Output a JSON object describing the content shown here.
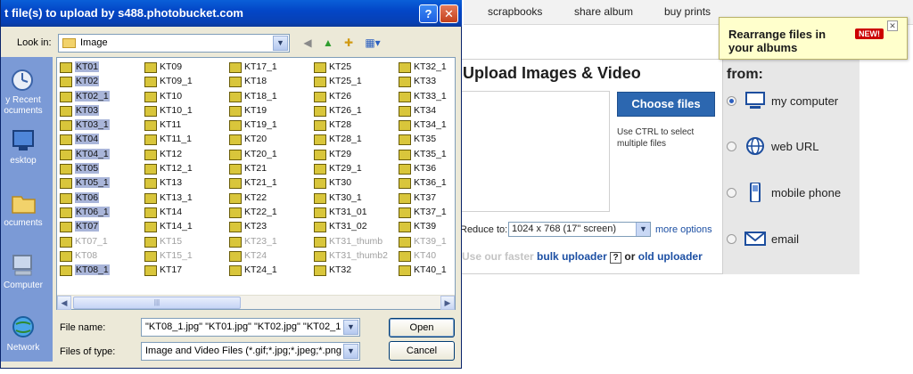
{
  "dialog": {
    "title": "t file(s) to upload by s488.photobucket.com",
    "help_label": "?",
    "close_label": "✕",
    "look_in_label": "Look in:",
    "look_in_value": "Image",
    "places": [
      {
        "label": "y Recent\nocuments",
        "icon": "recent-documents-icon"
      },
      {
        "label": "esktop",
        "icon": "desktop-icon"
      },
      {
        "label": "ocuments",
        "icon": "my-documents-icon"
      },
      {
        "label": "Computer",
        "icon": "my-computer-icon"
      },
      {
        "label": "Network",
        "icon": "network-icon"
      }
    ],
    "file_columns": [
      [
        {
          "name": "KT01",
          "sel": true
        },
        {
          "name": "KT02",
          "sel": true
        },
        {
          "name": "KT02_1",
          "sel": true
        },
        {
          "name": "KT03",
          "sel": true
        },
        {
          "name": "KT03_1",
          "sel": true
        },
        {
          "name": "KT04",
          "sel": true
        },
        {
          "name": "KT04_1",
          "sel": true
        },
        {
          "name": "KT05",
          "sel": true
        },
        {
          "name": "KT05_1",
          "sel": true
        },
        {
          "name": "KT06",
          "sel": true
        },
        {
          "name": "KT06_1",
          "sel": true
        },
        {
          "name": "KT07",
          "sel": true
        },
        {
          "name": "KT07_1",
          "dim": true
        },
        {
          "name": "KT08",
          "dim": true
        },
        {
          "name": "KT08_1",
          "sel": true
        }
      ],
      [
        {
          "name": "KT09"
        },
        {
          "name": "KT09_1"
        },
        {
          "name": "KT10"
        },
        {
          "name": "KT10_1"
        },
        {
          "name": "KT11"
        },
        {
          "name": "KT11_1"
        },
        {
          "name": "KT12"
        },
        {
          "name": "KT12_1"
        },
        {
          "name": "KT13"
        },
        {
          "name": "KT13_1"
        },
        {
          "name": "KT14"
        },
        {
          "name": "KT14_1"
        },
        {
          "name": "KT15",
          "dim": true
        },
        {
          "name": "KT15_1",
          "dim": true
        },
        {
          "name": "KT17"
        }
      ],
      [
        {
          "name": "KT17_1"
        },
        {
          "name": "KT18"
        },
        {
          "name": "KT18_1"
        },
        {
          "name": "KT19"
        },
        {
          "name": "KT19_1"
        },
        {
          "name": "KT20"
        },
        {
          "name": "KT20_1"
        },
        {
          "name": "KT21"
        },
        {
          "name": "KT21_1"
        },
        {
          "name": "KT22"
        },
        {
          "name": "KT22_1"
        },
        {
          "name": "KT23"
        },
        {
          "name": "KT23_1",
          "dim": true
        },
        {
          "name": "KT24",
          "dim": true
        },
        {
          "name": "KT24_1"
        }
      ],
      [
        {
          "name": "KT25"
        },
        {
          "name": "KT25_1"
        },
        {
          "name": "KT26"
        },
        {
          "name": "KT26_1"
        },
        {
          "name": "KT28"
        },
        {
          "name": "KT28_1"
        },
        {
          "name": "KT29"
        },
        {
          "name": "KT29_1"
        },
        {
          "name": "KT30"
        },
        {
          "name": "KT30_1"
        },
        {
          "name": "KT31_01"
        },
        {
          "name": "KT31_02"
        },
        {
          "name": "KT31_thumb",
          "dim": true
        },
        {
          "name": "KT31_thumb2",
          "dim": true
        },
        {
          "name": "KT32"
        }
      ],
      [
        {
          "name": "KT32_1"
        },
        {
          "name": "KT33"
        },
        {
          "name": "KT33_1"
        },
        {
          "name": "KT34"
        },
        {
          "name": "KT34_1"
        },
        {
          "name": "KT35"
        },
        {
          "name": "KT35_1"
        },
        {
          "name": "KT36"
        },
        {
          "name": "KT36_1"
        },
        {
          "name": "KT37"
        },
        {
          "name": "KT37_1"
        },
        {
          "name": "KT39"
        },
        {
          "name": "KT39_1",
          "dim": true
        },
        {
          "name": "KT40",
          "dim": true
        },
        {
          "name": "KT40_1"
        }
      ]
    ],
    "scroll_left": "◀",
    "scroll_right": "▶",
    "scroll_grip": "|||",
    "file_name_label": "File name:",
    "file_name_value": "\"KT08_1.jpg\" \"KT01.jpg\" \"KT02.jpg\" \"KT02_1",
    "file_type_label": "Files of type:",
    "file_type_value": "Image and Video Files (*.gif;*.jpg;*.jpeg;*.png;*.l",
    "open_label": "Open",
    "cancel_label": "Cancel"
  },
  "nav": {
    "scrapbooks": "scrapbooks",
    "share_album": "share album",
    "buy_prints": "buy prints"
  },
  "tooltip": {
    "text": "Rearrange files in your albums",
    "badge": "NEW!",
    "close": "✕"
  },
  "upload": {
    "title": "Upload Images & Video",
    "choose_files": "Choose files",
    "ctrl_hint": "Use CTRL to select multiple files",
    "reduce_label": "Reduce to:",
    "reduce_value": "1024 x 768 (17\" screen)",
    "more_options": "more options",
    "faster_prefix": "Use our faster",
    "bulk": "bulk",
    "uploader": "uploader",
    "help": "?",
    "or": "or",
    "old_uploader": "old uploader"
  },
  "sources": {
    "title": "from:",
    "items": [
      {
        "label": "my computer",
        "icon": "computer-icon",
        "selected": true
      },
      {
        "label": "web URL",
        "icon": "globe-icon",
        "selected": false
      },
      {
        "label": "mobile phone",
        "icon": "mobile-phone-icon",
        "selected": false
      },
      {
        "label": "email",
        "icon": "envelope-icon",
        "selected": false
      }
    ]
  },
  "colors": {
    "titlebar": "#0346c7",
    "choose_button": "#2c67b0",
    "link": "#1c4fa3",
    "tooltip_bg": "#ffffcc"
  }
}
